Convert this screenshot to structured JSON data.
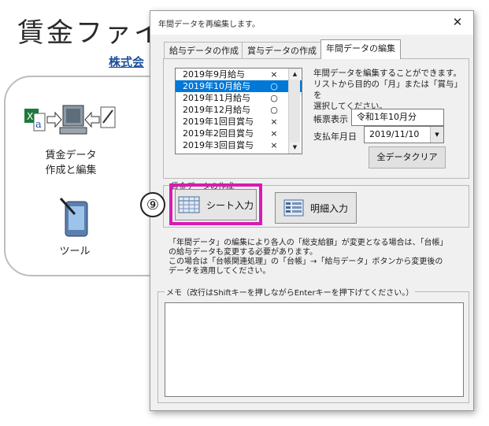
{
  "background": {
    "app_title": "賃金ファイ",
    "company_link": "株式会",
    "tiles": [
      {
        "icon": "wage-data-edit-icon",
        "label_line1": "賃金データ",
        "label_line2": "作成と編集"
      },
      {
        "icon": "phone-tool-icon",
        "label": "ツール"
      }
    ]
  },
  "dialog": {
    "title": "年間データを再編集します。",
    "close_label": "✕",
    "tabs": [
      {
        "label": "給与データの作成",
        "active": false
      },
      {
        "label": "賞与データの作成",
        "active": false
      },
      {
        "label": "年間データの編集",
        "active": true
      }
    ],
    "list": {
      "items": [
        {
          "label": "2019年9月給与",
          "mark": "×",
          "selected": false
        },
        {
          "label": "2019年10月給与",
          "mark": "○",
          "selected": true
        },
        {
          "label": "2019年11月給与",
          "mark": "○",
          "selected": false
        },
        {
          "label": "2019年12月給与",
          "mark": "○",
          "selected": false
        },
        {
          "label": "2019年1回目賞与",
          "mark": "×",
          "selected": false
        },
        {
          "label": "2019年2回目賞与",
          "mark": "×",
          "selected": false
        },
        {
          "label": "2019年3回目賞与",
          "mark": "×",
          "selected": false
        }
      ]
    },
    "description_lines": [
      "年間データを編集することができます。",
      "リストから目的の「月」または「賞与」を",
      "選択してください。"
    ],
    "form": {
      "display_label": "帳票表示",
      "display_value": "令和1年10月分",
      "pay_date_label": "支払年月日",
      "pay_date_value": "2019/11/10",
      "clear_all_label": "全データクリア"
    },
    "wage_group": {
      "title": "賃金データの作成",
      "step_number": "⑨",
      "sheet_input_label": "シート入力",
      "detail_input_label": "明細入力",
      "highlight_color": "#d81ab1"
    },
    "notice_lines": [
      "「年間データ」の編集により各人の「総支給額」が変更となる場合は、「台帳」",
      "の給与データも変更する必要があります。",
      "この場合は「台帳関連処理」の「台帳」→「給与データ」ボタンから変更後の",
      "データを適用してください。"
    ],
    "memo": {
      "title": "メモ（改行はShiftキーを押しながらEnterキーを押下げてください。）",
      "value": ""
    }
  },
  "colors": {
    "selection_blue": "#0078d7",
    "link_blue": "#1a4f9c",
    "dialog_bg": "#f0f0f0"
  }
}
